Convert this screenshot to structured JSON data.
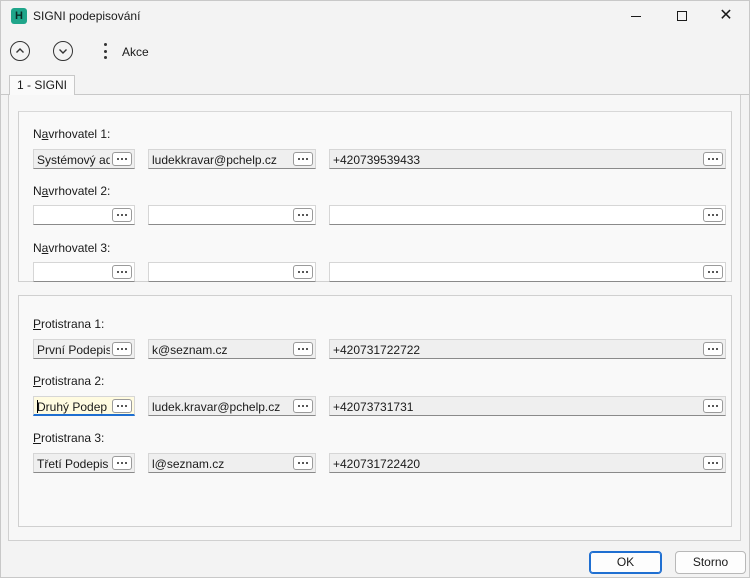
{
  "window": {
    "app_icon_letter": "H",
    "title": "SIGNI podepisování"
  },
  "toolbar": {
    "actions_label": "Akce"
  },
  "tabs": [
    {
      "label": "1 - SIGNI",
      "active": true
    }
  ],
  "navrhovatel": [
    {
      "label_prefix": "N",
      "label_underlined": "a",
      "label_rest": "vrhovatel 1:",
      "name": "Systémový ad",
      "email": "ludekkravar@pchelp.cz",
      "phone": "+420739539433"
    },
    {
      "label_prefix": "N",
      "label_underlined": "a",
      "label_rest": "vrhovatel 2:",
      "name": "",
      "email": "",
      "phone": ""
    },
    {
      "label_prefix": "N",
      "label_underlined": "a",
      "label_rest": "vrhovatel 3:",
      "name": "",
      "email": "",
      "phone": ""
    }
  ],
  "protistrana": [
    {
      "label_underlined": "P",
      "label_rest": "rotistrana 1:",
      "name": "První Podepis",
      "email": "k@seznam.cz",
      "phone": "+420731722722"
    },
    {
      "label_underlined": "P",
      "label_rest": "rotistrana 2:",
      "name": "Druhý Podep",
      "email": "ludek.kravar@pchelp.cz",
      "phone": "+42073731731"
    },
    {
      "label_underlined": "P",
      "label_rest": "rotistrana 3:",
      "name": "Třetí Podepis",
      "email": "l@seznam.cz",
      "phone": "+420731722420"
    }
  ],
  "buttons": {
    "ok": "OK",
    "storno": "Storno"
  },
  "colors": {
    "accent": "#1f6fd1",
    "app_icon": "#1fa58a",
    "focus_field": "#fffbe0"
  }
}
